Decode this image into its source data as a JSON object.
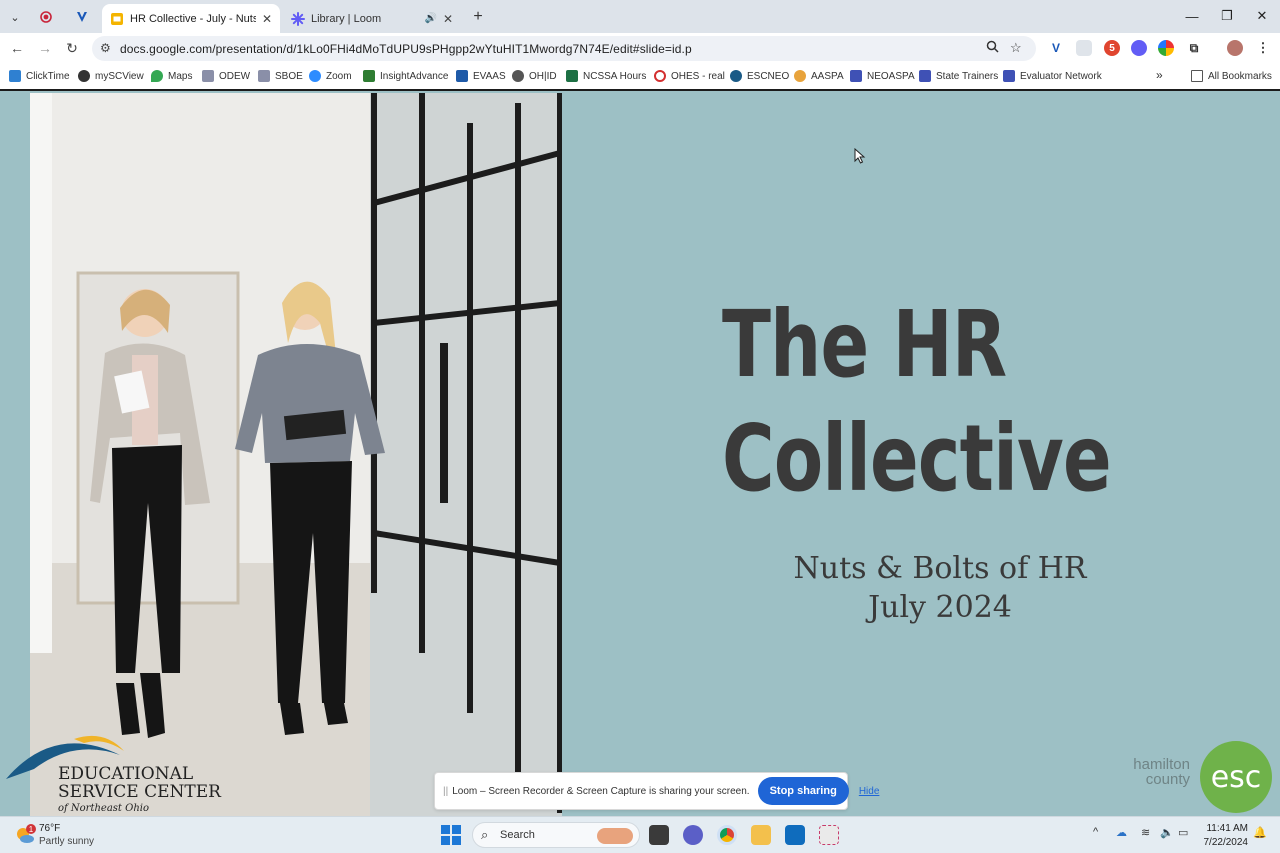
{
  "browser": {
    "tabs": [
      {
        "title": "HR Collective - July - Nuts & Bolts",
        "active": true
      },
      {
        "title": "Library | Loom",
        "active": false
      }
    ],
    "url": "docs.google.com/presentation/d/1kLo0FHi4dMoTdUPU9sPHgpp2wYtuHIT1Mwordg7N74E/edit#slide=id.p",
    "extension_badge": "5",
    "bookmarks": [
      "ClickTime",
      "mySCView",
      "Maps",
      "ODEW",
      "SBOE",
      "Zoom",
      "InsightAdvance",
      "EVAAS",
      "OH|ID",
      "NCSSA Hours",
      "OHES - real",
      "ESCNEO",
      "AASPA",
      "NEOASPA",
      "State Trainers",
      "Evaluator Network"
    ],
    "all_bookmarks": "All Bookmarks",
    "overflow": "»"
  },
  "slide": {
    "title_line1": "The HR",
    "title_line2": "Collective",
    "subtitle_line1": "Nuts & Bolts of HR",
    "subtitle_line2": "July 2024",
    "logo_left": {
      "line1": "EDUCATIONAL",
      "line2": "SERVICE CENTER",
      "line3": "of Northeast Ohio"
    },
    "logo_right": {
      "line1": "hamilton",
      "line2": "county",
      "mark": "esc"
    },
    "colors": {
      "background": "#9dc0c5",
      "title": "#3a3a3a",
      "esc_green": "#6fb24a",
      "logo_blue": "#1a5a86"
    }
  },
  "loom": {
    "message": "Loom – Screen Recorder & Screen Capture is sharing your screen.",
    "stop_label": "Stop sharing",
    "hide_label": "Hide"
  },
  "taskbar": {
    "weather_badge": "1",
    "weather_temp": "76°F",
    "weather_cond": "Partly sunny",
    "search_label": "Search",
    "time": "11:41 AM",
    "date": "7/22/2024"
  }
}
